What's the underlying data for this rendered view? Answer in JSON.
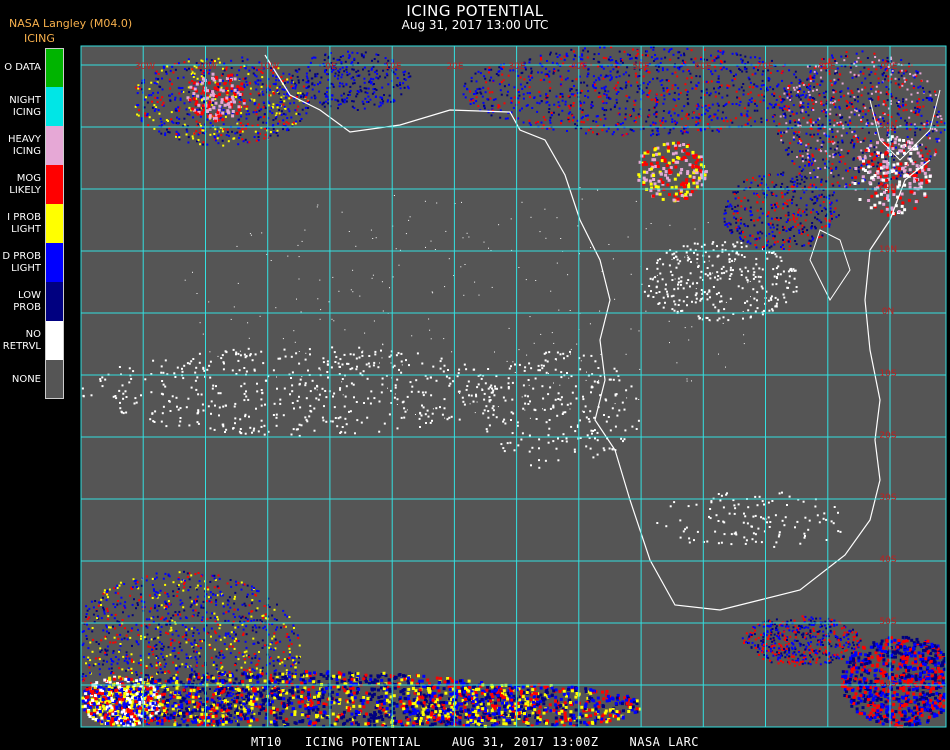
{
  "header": {
    "source": "NASA Langley (M04.0)",
    "product": "ICING",
    "title": "ICING POTENTIAL",
    "subtitle": "Aug 31, 2017 13:00 UTC"
  },
  "legend": [
    {
      "line1": "O DATA",
      "line2": "",
      "color": "#00b400"
    },
    {
      "line1": "NIGHT",
      "line2": "ICING",
      "color": "#00e6e6"
    },
    {
      "line1": "HEAVY",
      "line2": "ICING",
      "color": "#e6a8d6"
    },
    {
      "line1": "MOG",
      "line2": "LIKELY",
      "color": "#ff0000"
    },
    {
      "line1": "I PROB",
      "line2": "LIGHT",
      "color": "#ffff00"
    },
    {
      "line1": "D PROB",
      "line2": "LIGHT",
      "color": "#0000ff"
    },
    {
      "line1": "LOW",
      "line2": "PROB",
      "color": "#000080"
    },
    {
      "line1": "NO",
      "line2": "RETRVL",
      "color": "#ffffff"
    },
    {
      "line1": "NONE",
      "line2": "",
      "color": "#555555"
    }
  ],
  "map": {
    "background_color": "#555555",
    "grid_color": "#33e0e0",
    "coast_color": "#ffffff",
    "label_color": "#c02020",
    "top_labels": [
      "30W",
      "20W",
      "10W",
      "0E",
      "10E",
      "20E",
      "30E",
      "40E",
      "50E",
      "60E",
      "70E",
      "80E",
      "90E"
    ],
    "right_labels": [
      "30N",
      "20N",
      "10N",
      "0N",
      "10S",
      "20S",
      "30S",
      "40S",
      "50S",
      "60S"
    ]
  },
  "footer": "MT10   ICING POTENTIAL    AUG 31, 2017 13:00Z    NASA LARC"
}
